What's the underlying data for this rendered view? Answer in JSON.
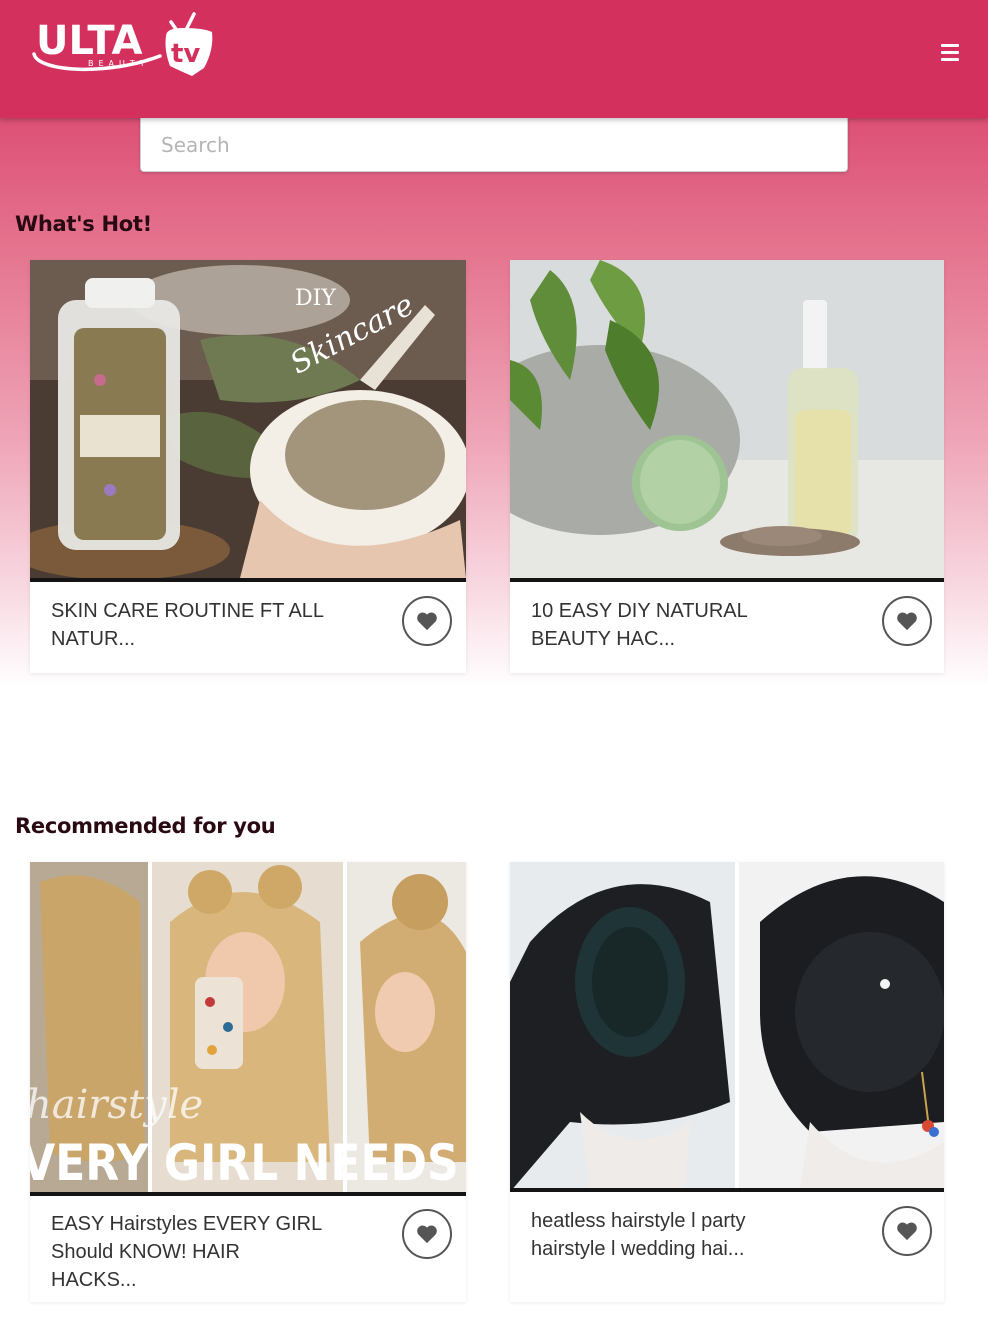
{
  "header": {
    "logo_main": "ULTA",
    "logo_sub": "BEAUTY",
    "logo_tv": "tv",
    "menu_icon": "hamburger-menu-icon",
    "background_color": "#d4305e"
  },
  "search": {
    "placeholder": "Search"
  },
  "sections": {
    "hot": {
      "title": "What's Hot!",
      "cards": [
        {
          "title": "SKIN CARE ROUTINE FT ALL NATUR...",
          "thumb_text": "DIY Skincare",
          "favorite_icon": "heart-icon"
        },
        {
          "title": "10 EASY DIY NATURAL BEAUTY HAC...",
          "favorite_icon": "heart-icon"
        }
      ]
    },
    "recommended": {
      "title": "Recommended for you",
      "cards": [
        {
          "title": "EASY Hairstyles EVERY GIRL Should KNOW! HAIR HACKS...",
          "thumb_text": "VERY GIRL NEEDS TO KNOW",
          "thumb_script": "hairstyle",
          "favorite_icon": "heart-icon"
        },
        {
          "title": "heatless hairstyle l party hairstyle l wedding hai...",
          "favorite_icon": "heart-icon"
        }
      ]
    }
  },
  "colors": {
    "brand": "#d4305e",
    "title_text": "#2a0a12",
    "card_text": "#333333"
  }
}
